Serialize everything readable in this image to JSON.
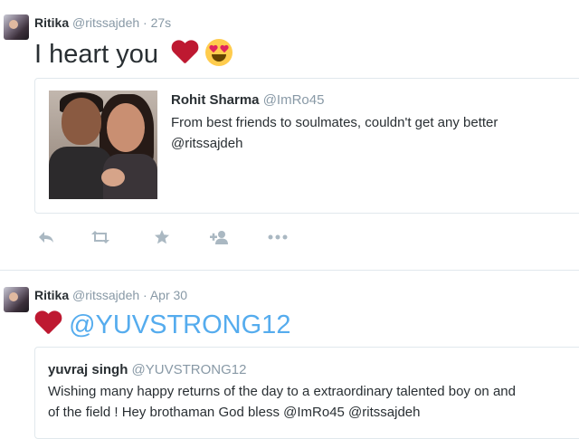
{
  "tweet1": {
    "author_name": "Ritika",
    "author_handle": "@ritssajdeh",
    "separator": "·",
    "time": "27s",
    "text": "I heart you",
    "emojis": [
      "red-heart",
      "heart-eyes-face"
    ],
    "quoted": {
      "author_name": "Rohit Sharma",
      "author_handle": "@ImRo45",
      "text_line1": "From best friends to soulmates, couldn't get any better",
      "text_line2": "@ritssajdeh"
    },
    "actions": [
      "reply-icon",
      "retweet-icon",
      "favorite-icon",
      "follow-icon",
      "more-icon"
    ]
  },
  "tweet2": {
    "author_name": "Ritika",
    "author_handle": "@ritssajdeh",
    "separator": "·",
    "time": "Apr 30",
    "emoji": "red-heart",
    "text": "@YUVSTRONG12",
    "quoted": {
      "author_name": "yuvraj singh",
      "author_handle": "@YUVSTRONG12",
      "text_line1": "Wishing many happy returns of the day to a extraordinary talented boy on and",
      "text_line2": "of the field ! Hey brothaman  God bless  @ImRo45 @ritssajdeh"
    }
  },
  "colors": {
    "link": "#55acee",
    "heart": "#be1931",
    "muted": "#8899a6",
    "icon": "#aab8c2",
    "border": "#e1e8ed"
  }
}
